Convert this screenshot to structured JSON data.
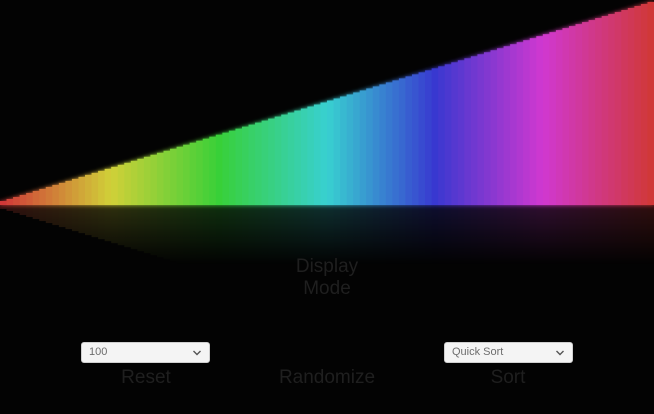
{
  "visualization": {
    "bar_count": 100,
    "state": "sorted ascending",
    "hue_start_deg": 0,
    "hue_end_deg": 360
  },
  "controls": {
    "display_mode_line1": "Display",
    "display_mode_line2": "Mode",
    "reset_label": "Reset",
    "randomize_label": "Randomize",
    "sort_label": "Sort",
    "count_dropdown_value": "100",
    "algorithm_dropdown_value": "Quick Sort"
  },
  "icons": {
    "dropdown_arrow": "chevron-down-icon"
  },
  "colors": {
    "background": "#030303",
    "button_text": "#1f1f1f",
    "dropdown_bg": "#f4f4f4"
  }
}
